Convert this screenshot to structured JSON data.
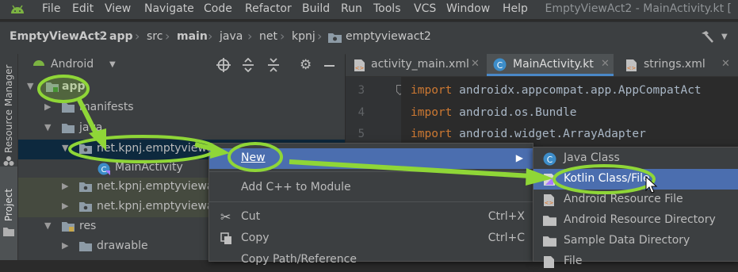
{
  "menubar": {
    "items": [
      "File",
      "Edit",
      "View",
      "Navigate",
      "Code",
      "Refactor",
      "Build",
      "Run",
      "Tools",
      "VCS",
      "Window",
      "Help"
    ],
    "window_title": "EmptyViewAct2 - MainActivity.kt ["
  },
  "breadcrumb": [
    "EmptyViewAct2",
    "app",
    "src",
    "main",
    "java",
    "net",
    "kpnj",
    "emptyviewact2"
  ],
  "side_stripe": {
    "resource_manager": "Resource Manager",
    "project": "Project"
  },
  "project_panel": {
    "view_selector": "Android"
  },
  "tree": {
    "app": "app",
    "manifests": "manifests",
    "java": "java",
    "pkg_main": "net.kpnj.emptyviewac",
    "main_activity": "MainActivity",
    "pkg_test1": "net.kpnj.emptyviewac",
    "pkg_test2": "net.kpnj.emptyviewac",
    "res": "res",
    "drawable": "drawable"
  },
  "editor": {
    "tabs": [
      "activity_main.xml",
      "MainActivity.kt",
      "strings.xml"
    ],
    "lines": [
      {
        "num": "3",
        "kw": "import",
        "text": " androidx.appcompat.app.AppCompatAct"
      },
      {
        "num": "4",
        "kw": "import",
        "text": " android.os.Bundle"
      },
      {
        "num": "5",
        "kw": "import",
        "text": " android.widget.ArrayAdapter"
      }
    ]
  },
  "context_menu": {
    "new": "New",
    "add_cpp": "Add C++ to Module",
    "cut": "Cut",
    "cut_shortcut": "Ctrl+X",
    "copy": "Copy",
    "copy_shortcut": "Ctrl+C",
    "copy_path": "Copy Path/Reference"
  },
  "submenu": {
    "java_class": "Java Class",
    "kotlin_class": "Kotlin Class/File",
    "android_resource_file": "Android Resource File",
    "android_resource_directory": "Android Resource Directory",
    "sample_data_directory": "Sample Data Directory",
    "file": "File"
  },
  "colors": {
    "selection": "#4b6eaf",
    "annotation": "#8fd637",
    "folder": "#8d9ba6",
    "keyword": "#cc7832"
  }
}
